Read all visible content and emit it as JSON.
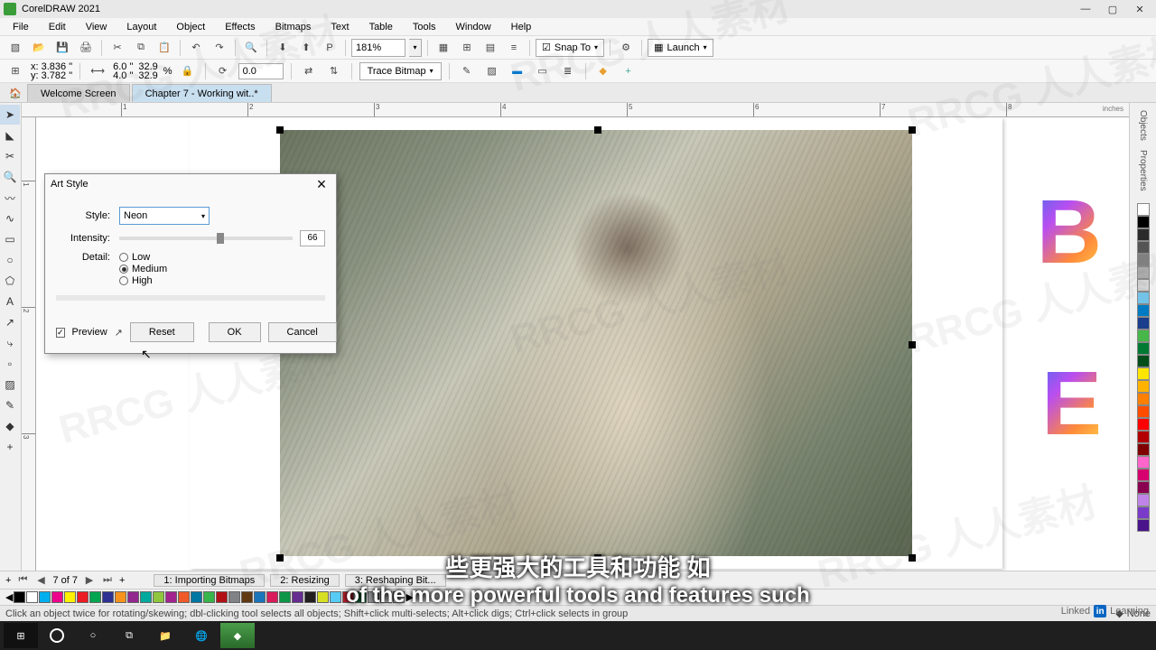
{
  "app": {
    "title": "CorelDRAW 2021"
  },
  "menu": {
    "file": "File",
    "edit": "Edit",
    "view": "View",
    "layout": "Layout",
    "object": "Object",
    "effects": "Effects",
    "bitmaps": "Bitmaps",
    "text": "Text",
    "table": "Table",
    "tools": "Tools",
    "window": "Window",
    "help": "Help"
  },
  "toolbar": {
    "zoom": "181%",
    "snap": "Snap To",
    "launch": "Launch"
  },
  "propbar": {
    "x": "x: 3.836 \"",
    "y": "y: 3.782 \"",
    "w": "6.0 \"",
    "h": "4.0 \"",
    "sx": "32.9",
    "sy": "32.9",
    "pct": "%",
    "rot": "0.0",
    "trace": "Trace Bitmap"
  },
  "tabs": {
    "welcome": "Welcome Screen",
    "doc": "Chapter 7 - Working wit..*"
  },
  "ruler": {
    "h": [
      "1",
      "2",
      "3",
      "4",
      "5",
      "6",
      "7",
      "8"
    ],
    "v": [
      "1",
      "2",
      "3"
    ],
    "units": "inches"
  },
  "dockers": {
    "objects": "Objects",
    "properties": "Properties"
  },
  "dialog": {
    "title": "Art Style",
    "style_label": "Style:",
    "style_value": "Neon",
    "intensity_label": "Intensity:",
    "intensity_value": "66",
    "detail_label": "Detail:",
    "detail_low": "Low",
    "detail_medium": "Medium",
    "detail_high": "High",
    "preview": "Preview",
    "reset": "Reset",
    "ok": "OK",
    "cancel": "Cancel"
  },
  "pagenav": {
    "page": "7 of 7",
    "t1": "1: Importing Bitmaps",
    "t2": "2: Resizing",
    "t3": "3: Reshaping Bit..."
  },
  "status": {
    "hint": "Click an object twice for rotating/skewing; dbl-clicking tool selects all objects; Shift+click multi-selects; Alt+click digs; Ctrl+click selects in group",
    "fill_none": "None"
  },
  "subtitle": {
    "cn": "些更强大的工具和功能 如",
    "en": "of the more powerful tools and features such"
  },
  "watermark": "RRCG 人人素材",
  "linkedin": "Linked",
  "linkedin2": "Learning",
  "palette_colors": [
    "#000",
    "#fff",
    "#00aeef",
    "#ed008c",
    "#fff100",
    "#ec1c24",
    "#00a550",
    "#2e3092",
    "#f7931d",
    "#91278f",
    "#00a99d",
    "#8fc63d",
    "#a3238e",
    "#f05a28",
    "#0076a3",
    "#38b54a",
    "#b11116",
    "#808285",
    "#603913",
    "#1b75bb",
    "#d91b5c",
    "#0d9648",
    "#662d91",
    "#231f20",
    "#d7df23",
    "#57cbf5",
    "#be1e2d",
    "#006838",
    "#929497",
    "#c4c6c8",
    "#e6e7e8"
  ],
  "right_colors": [
    "#fff",
    "#000",
    "#2b2b2b",
    "#555",
    "#808080",
    "#aaa",
    "#d4d4d4",
    "#73c2e8",
    "#007ac2",
    "#1a3e8c",
    "#47b749",
    "#007a33",
    "#004d1a",
    "#ffe600",
    "#ffb300",
    "#ff7f00",
    "#ff4d00",
    "#ff0000",
    "#b30000",
    "#800000",
    "#ff66cc",
    "#d6006e",
    "#8a0050",
    "#c084e8",
    "#7a3cc8",
    "#4a148c"
  ]
}
